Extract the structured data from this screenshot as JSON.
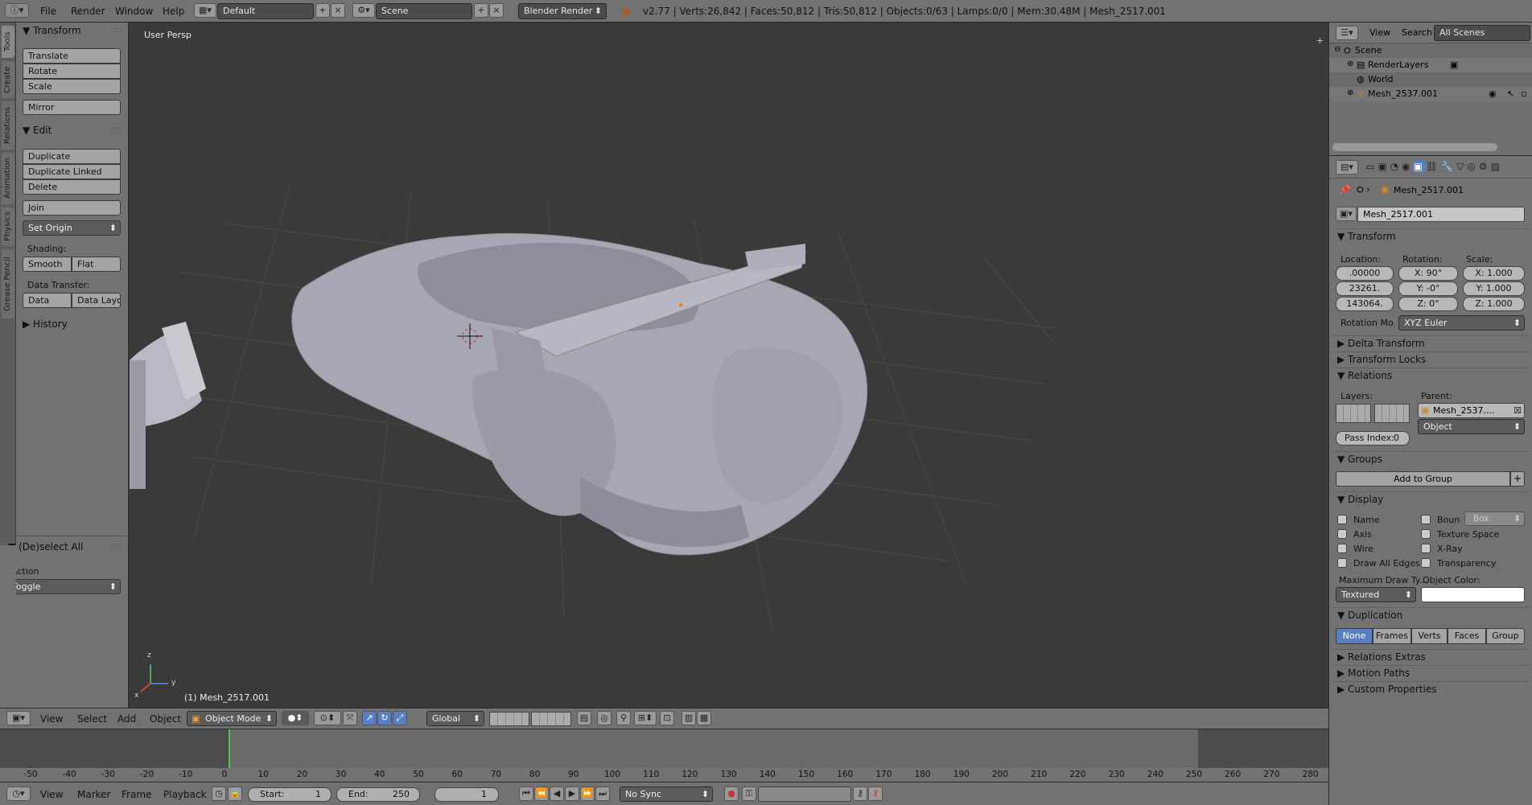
{
  "topbar": {
    "menus": [
      "File",
      "Render",
      "Window",
      "Help"
    ],
    "screen_layout": "Default",
    "scene": "Scene",
    "render_engine": "Blender Render",
    "stats": "v2.77 | Verts:26,842 | Faces:50,812 | Tris:50,812 | Objects:0/63 | Lamps:0/0 | Mem:30.48M | Mesh_2517.001"
  },
  "left_tabs": [
    "Tools",
    "Create",
    "Relations",
    "Animation",
    "Physics",
    "Grease Pencil"
  ],
  "tool_shelf": {
    "transform_header": "Transform",
    "transform_buttons": [
      "Translate",
      "Rotate",
      "Scale"
    ],
    "mirror": "Mirror",
    "edit_header": "Edit",
    "edit_buttons": [
      "Duplicate",
      "Duplicate Linked",
      "Delete"
    ],
    "join": "Join",
    "set_origin": "Set Origin",
    "shading_label": "Shading:",
    "smooth": "Smooth",
    "flat": "Flat",
    "data_transfer_label": "Data Transfer:",
    "data": "Data",
    "data_layout": "Data Layo",
    "history_header": "History",
    "operator_header": "(De)select All",
    "action_label": "Action",
    "action_value": "Toggle"
  },
  "viewport": {
    "view_label": "User Persp",
    "object_label": "(1) Mesh_2517.001",
    "axis_x": "x",
    "axis_y": "y",
    "axis_z": "z"
  },
  "outliner": {
    "view": "View",
    "search": "Search",
    "filter": "All Scenes",
    "items": [
      "Scene",
      "RenderLayers",
      "World",
      "Mesh_2537.001"
    ]
  },
  "properties": {
    "object_name_top": "Mesh_2517.001",
    "object_name_field": "Mesh_2517.001",
    "transform_header": "Transform",
    "location_label": "Location:",
    "rotation_label": "Rotation:",
    "scale_label": "Scale:",
    "location": [
      ".00000",
      "23261.",
      "143064."
    ],
    "rotation": [
      "X:  90°",
      "Y:  -0°",
      "Z:  0°"
    ],
    "scale": [
      "X: 1.000",
      "Y: 1.000",
      "Z: 1.000"
    ],
    "rotation_mode_label": "Rotation Mo",
    "rotation_mode": "XYZ Euler",
    "delta_transform": "Delta Transform",
    "transform_locks": "Transform Locks",
    "relations_header": "Relations",
    "layers_label": "Layers:",
    "parent_label": "Parent:",
    "parent_value": "Mesh_2537....",
    "parent_type": "Object",
    "pass_index_label": "Pass Index:",
    "pass_index_value": "0",
    "groups_header": "Groups",
    "add_to_group": "Add to Group",
    "display_header": "Display",
    "display_left": [
      "Name",
      "Axis",
      "Wire",
      "Draw All Edges"
    ],
    "display_right": [
      "Boun",
      "Texture Space",
      "X-Ray",
      "Transparency"
    ],
    "bounds_type": "Box",
    "max_draw_type_label": "Maximum Draw Ty...",
    "max_draw_type": "Textured",
    "object_color_label": "Object Color:",
    "duplication_header": "Duplication",
    "duplication_options": [
      "None",
      "Frames",
      "Verts",
      "Faces",
      "Group"
    ],
    "relations_extras": "Relations Extras",
    "motion_paths": "Motion Paths",
    "custom_properties": "Custom Properties"
  },
  "viewport_header": {
    "menus": [
      "View",
      "Select",
      "Add",
      "Object"
    ],
    "mode": "Object Mode",
    "orientation": "Global"
  },
  "timeline": {
    "ticks": [
      "-50",
      "-40",
      "-30",
      "-20",
      "-10",
      "0",
      "10",
      "20",
      "30",
      "40",
      "50",
      "60",
      "70",
      "80",
      "90",
      "100",
      "110",
      "120",
      "130",
      "140",
      "150",
      "160",
      "170",
      "180",
      "190",
      "200",
      "210",
      "220",
      "230",
      "240",
      "250",
      "260",
      "270",
      "280"
    ],
    "current_frame_marker": 1
  },
  "timeline_header": {
    "menus": [
      "View",
      "Marker",
      "Frame",
      "Playback"
    ],
    "start": "Start:",
    "start_value": "1",
    "end": "End:",
    "end_value": "250",
    "current": "1",
    "sync": "No Sync"
  },
  "colors": {
    "accent": "#5680c2",
    "panel": "#727272",
    "viewport_bg": "#3a3a3a"
  }
}
